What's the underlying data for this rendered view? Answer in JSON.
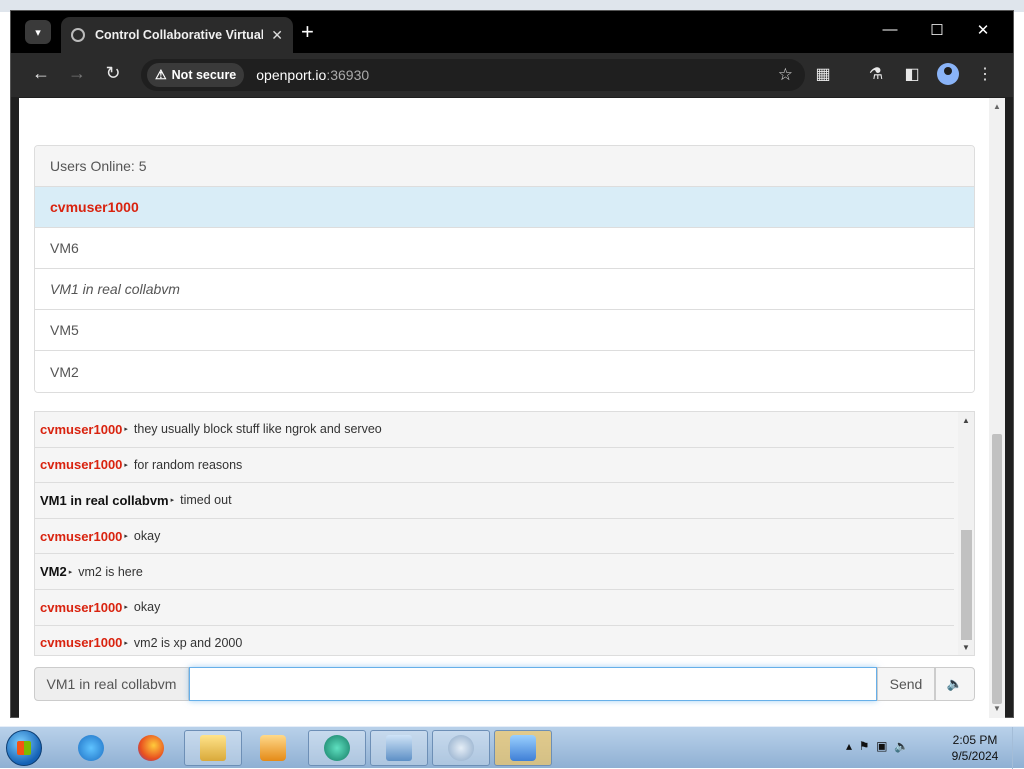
{
  "browser": {
    "tab_title": "Control Collaborative Virtual M",
    "url_host": "openport.io",
    "url_port": ":36930",
    "security_label": "Not secure"
  },
  "users": {
    "heading": "Users Online: 5",
    "list": [
      {
        "name": "cvmuser1000",
        "kind": "self"
      },
      {
        "name": "VM6",
        "kind": "normal"
      },
      {
        "name": "VM1 in real collabvm",
        "kind": "turn"
      },
      {
        "name": "VM5",
        "kind": "normal"
      },
      {
        "name": "VM2",
        "kind": "normal"
      }
    ]
  },
  "chat": {
    "messages": [
      {
        "user": "cvmuser1000",
        "text": "they usually block stuff like ngrok and serveo"
      },
      {
        "user": "cvmuser1000",
        "text": "for random reasons"
      },
      {
        "user": "VM1 in real collabvm",
        "text": "timed out"
      },
      {
        "user": "cvmuser1000",
        "text": "okay"
      },
      {
        "user": "VM2",
        "text": "vm2 is here"
      },
      {
        "user": "cvmuser1000",
        "text": "okay"
      },
      {
        "user": "cvmuser1000",
        "text": "vm2 is xp and 2000"
      }
    ],
    "username_label": "VM1 in real collabvm",
    "input_value": "",
    "send_label": "Send",
    "volume_icon": "volume-icon"
  },
  "taskbar": {
    "time": "2:05 PM",
    "date": "9/5/2024"
  },
  "colors": {
    "self_user": "#d9230f",
    "self_row_bg": "#d9edf7",
    "focus_border": "#66afe9"
  }
}
